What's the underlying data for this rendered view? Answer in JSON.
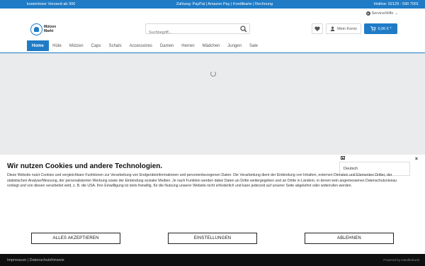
{
  "topbar": {
    "shipping": "kostenloser Versand ab 30€",
    "payment": "Zahlung: PayPal | Amazon Pay | Kreditkarte | Rechnung",
    "hotline": "Hotline: 02129 - 590 7001"
  },
  "header": {
    "service_label": "Service/Hilfe",
    "logo_line1": "Mützen",
    "logo_line2": "Markt",
    "search_placeholder": "Suchbegriff...",
    "account_label": "Mein Konto",
    "cart_label": "0,00 € *"
  },
  "nav": {
    "items": [
      "Home",
      "Hüte",
      "Mützen",
      "Caps",
      "Schals",
      "Accessoires",
      "Damen",
      "Herren",
      "Mädchen",
      "Jungen",
      "Sale"
    ]
  },
  "cookie": {
    "title": "Wir nutzen Cookies und andere Technologien.",
    "body": "Diese Website nutzt Cookies und vergleichbare Funktionen zur Verarbeitung von Endgeräteinformationen und personenbezogenen Daten. Die Verarbeitung dient der Einbindung von Inhalten, externen Diensten und Elementen Dritter, der statistischen Analyse/Messung, der personalisierten Werbung sowie der Einbindung sozialer Medien. Je nach Funktion werden dabei Daten an Dritte weitergegeben und an Dritte in Ländern, in denen kein angemessenes Datenschutzniveau vorliegt und von diesen verarbeitet wird, z. B. die USA. Ihre Einwilligung ist stets freiwillig, für die Nutzung unserer Website nicht erforderlich und kann jederzeit auf unserer Seite abgelehnt oder widerrufen werden.",
    "language": "Deutsch",
    "close": "×",
    "accept_all": "ALLES AKZEPTIEREN",
    "settings": "EINSTELLUNGEN",
    "reject": "ABLEHNEN"
  },
  "footer": {
    "links": "Impressum | Datenschutzhinweis",
    "powered": "Powered by Händlerbund"
  },
  "colors": {
    "brand_blue": "#1f7bc6",
    "footer_bg": "#0f0f0f"
  }
}
